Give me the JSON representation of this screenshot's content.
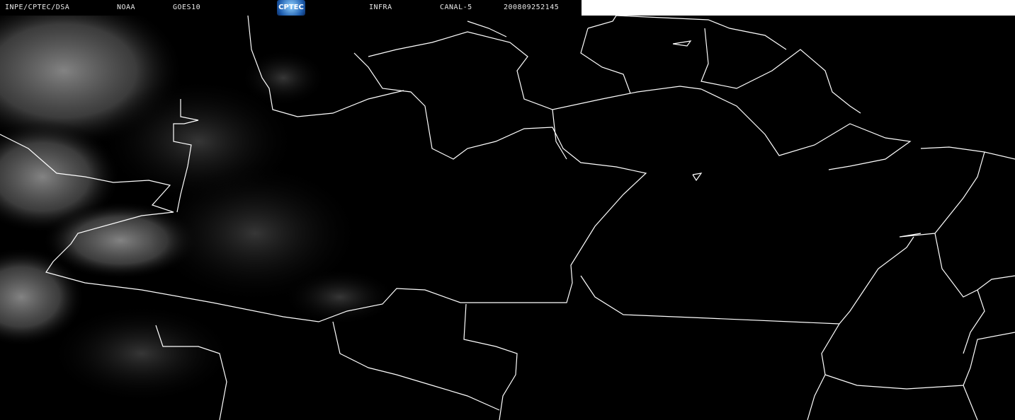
{
  "header": {
    "source": "INPE/CPTEC/DSA",
    "agency": "NOAA",
    "satellite": "GOES10",
    "logo_text": "CPTEC",
    "product": "INFRA",
    "channel": "CANAL-5",
    "timestamp": "200809252145"
  },
  "colors": {
    "border_line": "#ffffff",
    "background": "#000000",
    "cloud": "#9a9a9a"
  }
}
